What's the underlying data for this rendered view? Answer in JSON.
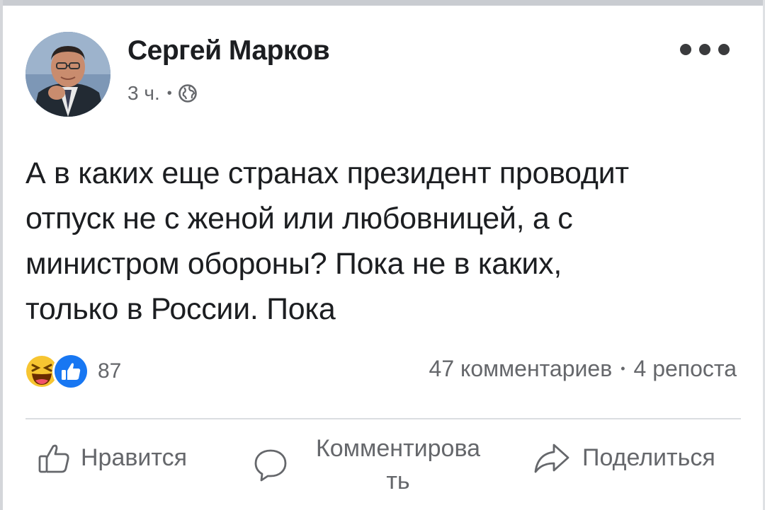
{
  "post": {
    "author": "Сергей Марков",
    "time": "3 ч.",
    "meta_separator": "•",
    "privacy_icon": "globe-icon",
    "more_icon": "more-options-icon",
    "text_lines": [
      "А в каких еще странах президент проводит",
      "отпуск не с женой или любовницей, а с",
      "министром обороны? Пока не в каких,",
      "только в России. Пока"
    ]
  },
  "reactions": {
    "icons": [
      "laugh-react-icon",
      "like-react-icon"
    ],
    "count": "87"
  },
  "stats": {
    "comments": "47 комментариев",
    "separator": "•",
    "shares": "4 репоста"
  },
  "actions": {
    "like": "Нравится",
    "comment_line1": "Комментирова",
    "comment_line2": "ть",
    "share": "Поделиться"
  },
  "colors": {
    "text": "#1c1e21",
    "secondary": "#65676b",
    "like_blue": "#1877f2",
    "haha_yellow": "#f7c531",
    "divider": "#dadde1"
  }
}
